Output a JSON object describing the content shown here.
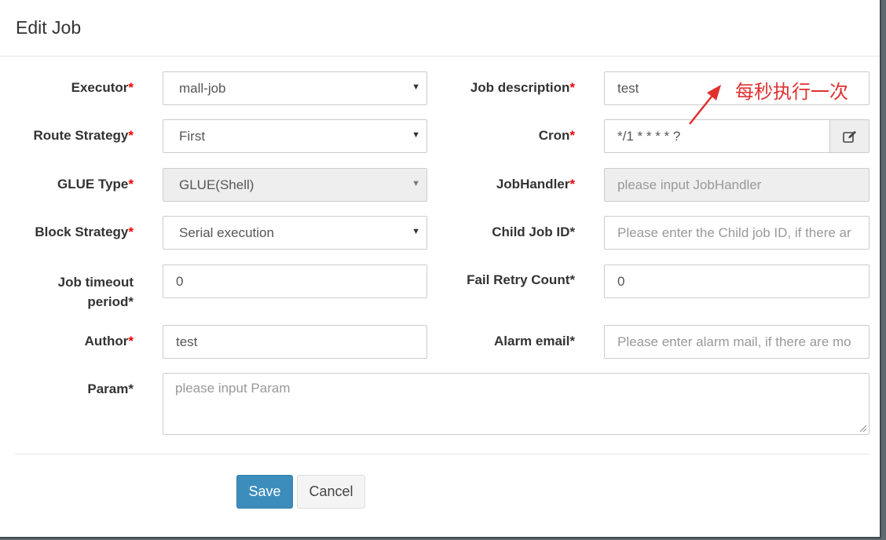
{
  "modal": {
    "title": "Edit Job"
  },
  "form": {
    "executor": {
      "label": "Executor",
      "value": "mall-job"
    },
    "job_description": {
      "label": "Job description",
      "value": "test"
    },
    "route_strategy": {
      "label": "Route Strategy",
      "value": "First"
    },
    "cron": {
      "label": "Cron",
      "value": "*/1 * * * * ?"
    },
    "glue_type": {
      "label": "GLUE Type",
      "value": "GLUE(Shell)"
    },
    "job_handler": {
      "label": "JobHandler",
      "placeholder": "please input JobHandler"
    },
    "block_strategy": {
      "label": "Block Strategy",
      "value": "Serial execution"
    },
    "child_job_id": {
      "label": "Child Job ID",
      "placeholder": "Please enter the Child job ID, if there ar"
    },
    "job_timeout": {
      "label_line1": "Job timeout",
      "label_line2": "period",
      "value": "0"
    },
    "fail_retry_count": {
      "label": "Fail Retry Count",
      "value": "0"
    },
    "author": {
      "label": "Author",
      "value": "test"
    },
    "alarm_email": {
      "label": "Alarm email",
      "placeholder": "Please enter alarm mail, if there are mo"
    },
    "param": {
      "label": "Param",
      "placeholder": "please input Param"
    },
    "required_mark": "*"
  },
  "buttons": {
    "save": "Save",
    "cancel": "Cancel"
  },
  "annotation": {
    "text": "每秒执行一次",
    "color": "#e03030"
  },
  "icons": {
    "select_caret": "caret-down-icon",
    "cron_edit": "edit-icon"
  }
}
